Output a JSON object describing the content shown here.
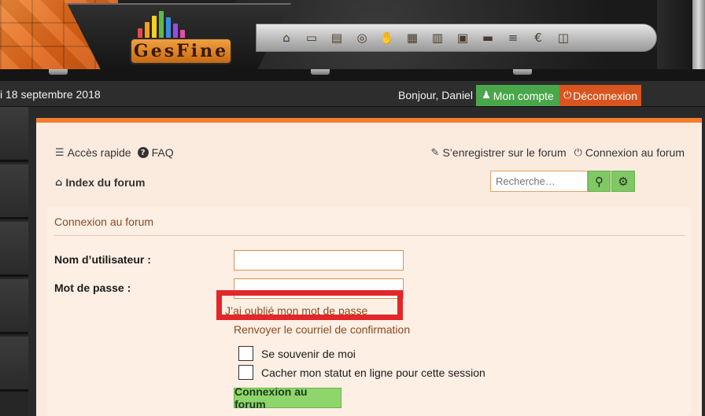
{
  "banner": {
    "logo_text": "GesFine",
    "logo_bar_colors": [
      "#e84a4a",
      "#f0a020",
      "#f4d020",
      "#60b84a",
      "#3a8ae0",
      "#9a4ae0",
      "#e84ab0"
    ],
    "icons": [
      {
        "name": "bank-icon",
        "glyph": "⌂"
      },
      {
        "name": "banknote-icon",
        "glyph": "▭"
      },
      {
        "name": "cash-register-icon",
        "glyph": "▤"
      },
      {
        "name": "coin-icon",
        "glyph": "◎"
      },
      {
        "name": "hand-coin-icon",
        "glyph": "✋"
      },
      {
        "name": "gold-bars-icon",
        "glyph": "▦"
      },
      {
        "name": "chart-bars-icon",
        "glyph": "▥"
      },
      {
        "name": "safe-icon",
        "glyph": "▣"
      },
      {
        "name": "card-hand-icon",
        "glyph": "▬"
      },
      {
        "name": "coin-stack-icon",
        "glyph": "≡"
      },
      {
        "name": "euro-icon",
        "glyph": "€"
      },
      {
        "name": "wallet-icon",
        "glyph": "◫"
      }
    ]
  },
  "statusbar": {
    "date": "i 18 septembre 2018",
    "greeting": "Bonjour, Daniel",
    "account_label": "Mon compte",
    "logout_label": "Déconnexion"
  },
  "nav": {
    "quick_access": "Accès rapide",
    "faq": "FAQ",
    "register": "S’enregistrer sur le forum",
    "login": "Connexion au forum",
    "breadcrumb": "Index du forum",
    "search_placeholder": "Recherche…"
  },
  "login": {
    "title": "Connexion au forum",
    "username_label": "Nom d’utilisateur :",
    "password_label": "Mot de passe :",
    "forgot_password": "J’ai oublié mon mot de passe",
    "resend_email": "Renvoyer le courriel de confirmation",
    "remember_me": "Se souvenir de moi",
    "hide_status": "Cacher mon statut en ligne pour cette session",
    "submit_label": "Connexion au forum"
  },
  "colors": {
    "accent_orange": "#f47e30",
    "account_green": "#4aa64a",
    "logout_orange": "#d9541e",
    "highlight_red": "#e2262a"
  }
}
